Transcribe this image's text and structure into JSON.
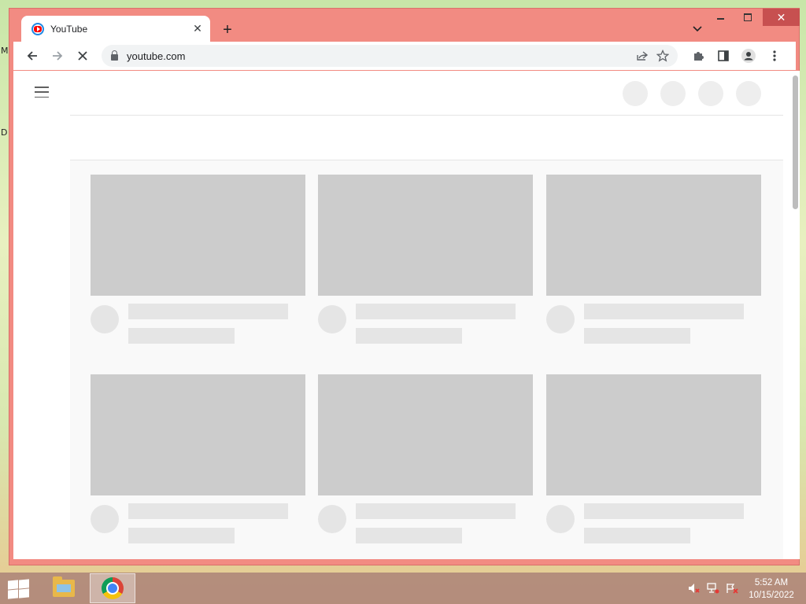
{
  "desktop": {
    "edge_letters": [
      "M",
      "D"
    ]
  },
  "browser": {
    "tab": {
      "title": "YouTube",
      "favicon": "youtube-icon",
      "close_glyph": "✕"
    },
    "new_tab_glyph": "+",
    "tab_search_glyph": "⌄",
    "window_controls": {
      "close_glyph": "✕"
    },
    "toolbar": {
      "back_glyph": "←",
      "forward_glyph": "→",
      "stop_glyph": "✕",
      "url": "youtube.com",
      "share_glyph": "⇪",
      "bookmark_glyph": "☆",
      "extensions_glyph": "✱",
      "sidepanel_glyph": "◧",
      "profile_glyph": "●",
      "menu_glyph": "⋮"
    }
  },
  "page": {
    "loading": true,
    "skeleton_cards": 6
  },
  "taskbar": {
    "clock_time": "5:52 AM",
    "clock_date": "10/15/2022",
    "tray_icons": [
      "volume-muted-icon",
      "network-icon",
      "action-center-flag-icon"
    ]
  },
  "colors": {
    "titlebar": "#f28b82",
    "skeleton_thumb": "#cccccc",
    "skeleton_line": "#e5e5e5",
    "feed_bg": "#f9f9f9"
  }
}
